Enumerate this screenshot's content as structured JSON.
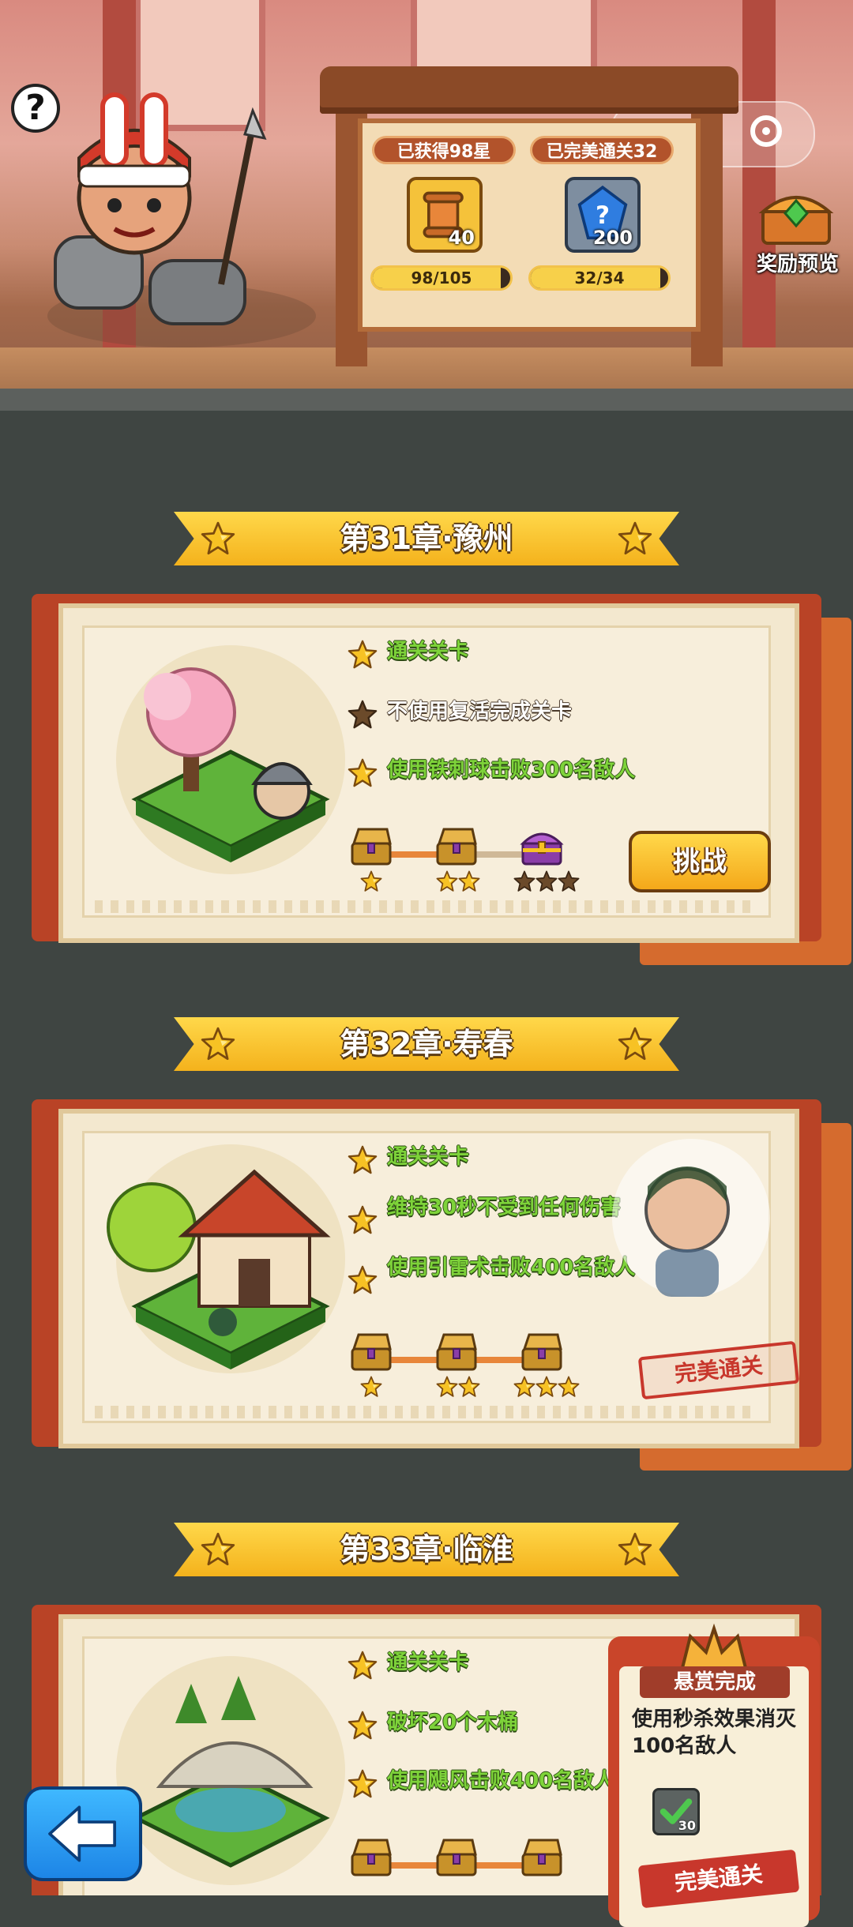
{
  "header": {
    "help_label": "?",
    "capsule_dots": "•••",
    "stats": [
      {
        "title": "已获得98星",
        "icon": "scroll-icon",
        "icon_count": "40",
        "progress_text": "98/105",
        "progress": 0.933
      },
      {
        "title": "已完美通关32",
        "icon": "mystery-gem-icon",
        "icon_count": "200",
        "progress_text": "32/34",
        "progress": 0.941
      }
    ],
    "reward_preview_label": "奖励预览"
  },
  "chapters": [
    {
      "title": "第31章·豫州",
      "objectives": [
        {
          "text": "通关关卡",
          "achieved": true
        },
        {
          "text": "不使用复活完成关卡",
          "achieved": false
        },
        {
          "text": "使用铁刺球击败300名敌人",
          "achieved": true
        }
      ],
      "action_label": "挑战",
      "milestones": [
        1,
        2,
        3
      ],
      "stars_earned": 2
    },
    {
      "title": "第32章·寿春",
      "objectives": [
        {
          "text": "通关关卡",
          "achieved": true
        },
        {
          "text": "维持30秒不受到任何伤害",
          "achieved": true
        },
        {
          "text": "使用引雷术击败400名敌人",
          "achieved": true
        }
      ],
      "stamp_label": "完美通关",
      "milestones": [
        1,
        2,
        3
      ],
      "stars_earned": 3
    },
    {
      "title": "第33章·临淮",
      "objectives": [
        {
          "text": "通关关卡",
          "achieved": true
        },
        {
          "text": "破坏20个木桶",
          "achieved": true
        },
        {
          "text": "使用飓风击败400名敌人",
          "achieved": true
        }
      ],
      "stars_earned": 3
    }
  ],
  "bounty": {
    "badge_label": "悬赏完成",
    "description": "使用秒杀效果消灭100名敌人",
    "item_count": "30",
    "stamp_label": "完美通关"
  },
  "colors": {
    "objective_green": "#7ed33a",
    "star_gold": "#f7c224",
    "star_brown": "#6b4a2a",
    "banner_yellow": "#ffd84a",
    "card_red": "#b94326",
    "stamp_red": "#c8372c",
    "back_button_blue": "#2a9cf5"
  }
}
